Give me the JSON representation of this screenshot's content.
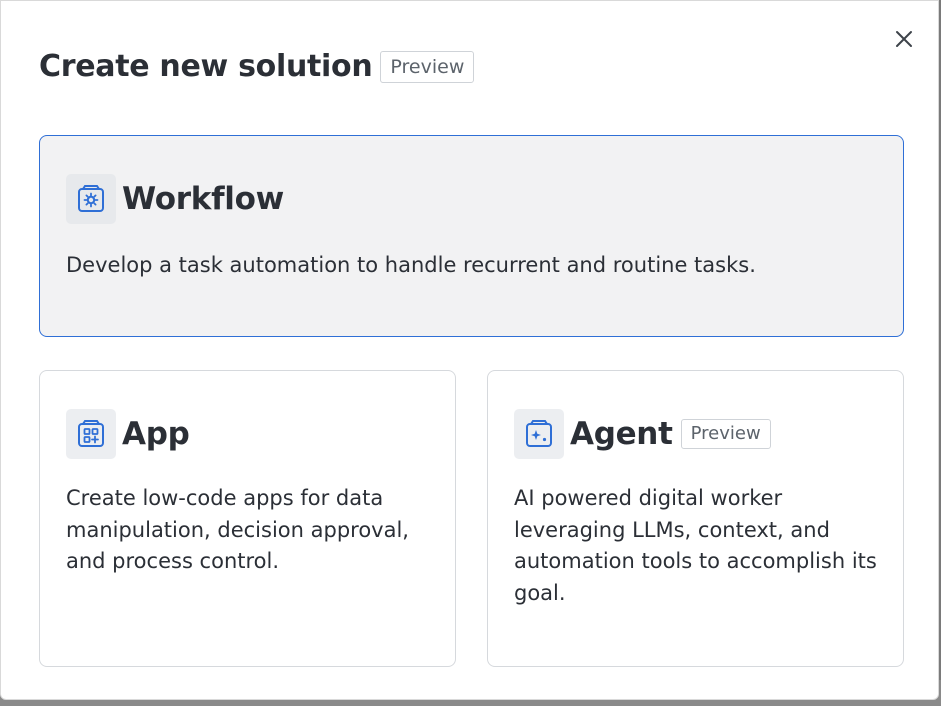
{
  "dialog": {
    "title": "Create new solution",
    "badge": "Preview",
    "close_icon": "close-icon"
  },
  "options": [
    {
      "id": "workflow",
      "title": "Workflow",
      "description": "Develop a task automation to handle recurrent and routine tasks.",
      "icon": "workflow-gear-icon",
      "selected": true
    },
    {
      "id": "app",
      "title": "App",
      "description": "Create low-code apps for data manipulation, decision approval, and process control.",
      "icon": "app-grid-icon",
      "selected": false
    },
    {
      "id": "agent",
      "title": "Agent",
      "badge": "Preview",
      "description": "AI powered digital worker leveraging LLMs, context, and automation tools to accomplish its goal.",
      "icon": "agent-sparkle-icon",
      "selected": false
    }
  ],
  "colors": {
    "accent": "#2f6fd6",
    "text": "#2b2f36",
    "badge_text": "#5c636b",
    "selected_bg": "#f2f2f3"
  }
}
